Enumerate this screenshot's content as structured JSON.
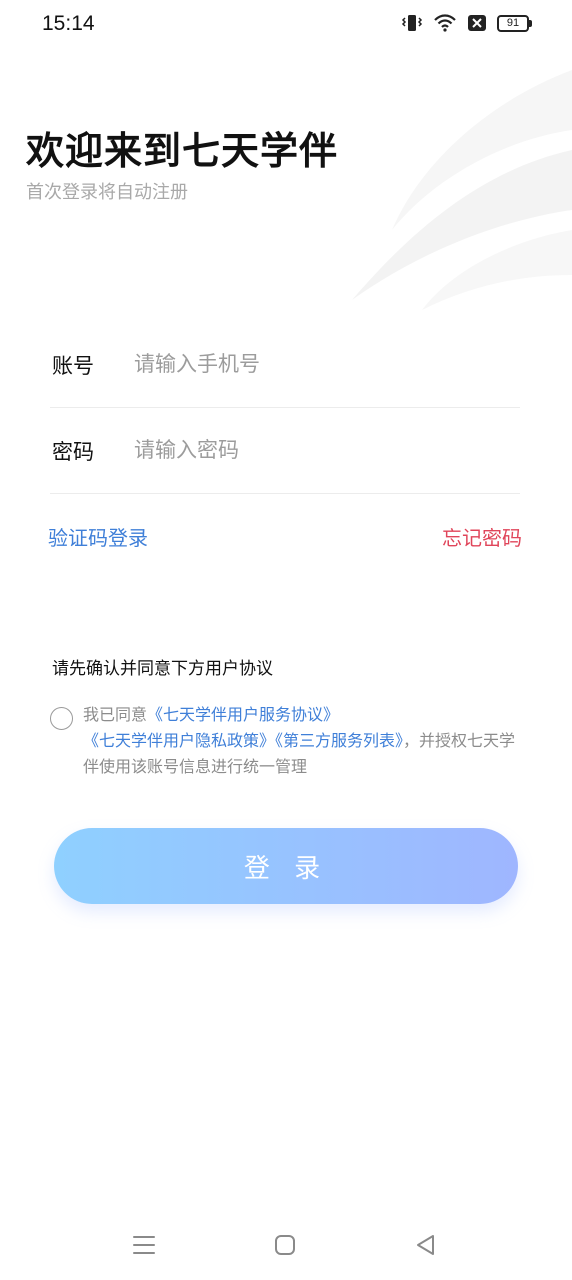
{
  "status_bar": {
    "time": "15:14",
    "icons": [
      "vibrate-icon",
      "wifi-icon",
      "signal-off-icon",
      "battery-icon"
    ],
    "battery": "91"
  },
  "header": {
    "title": "欢迎来到七天学伴",
    "subtitle": "首次登录将自动注册"
  },
  "form": {
    "account_label": "账号",
    "account_placeholder": "请输入手机号",
    "account_value": "",
    "password_label": "密码",
    "password_placeholder": "请输入密码",
    "password_value": ""
  },
  "links": {
    "code_login": "验证码登录",
    "forgot_password": "忘记密码"
  },
  "agreement": {
    "title": "请先确认并同意下方用户协议",
    "checked": false,
    "prefix": "我已同意",
    "link1": "《七天学伴用户服务协议》",
    "link2": "《七天学伴用户隐私政策》",
    "link3": "《第三方服务列表》",
    "suffix": "，并授权七天学伴使用该账号信息进行统一管理"
  },
  "login_button": "登 录",
  "nav_bar": {
    "icons": [
      "menu-icon",
      "home-icon",
      "back-icon"
    ]
  },
  "colors": {
    "link_blue": "#3f7fd8",
    "link_red": "#e0455a",
    "button_gradient_start": "#8fd0ff",
    "button_gradient_end": "#9fb6ff",
    "placeholder_gray": "#9c9c9c"
  }
}
